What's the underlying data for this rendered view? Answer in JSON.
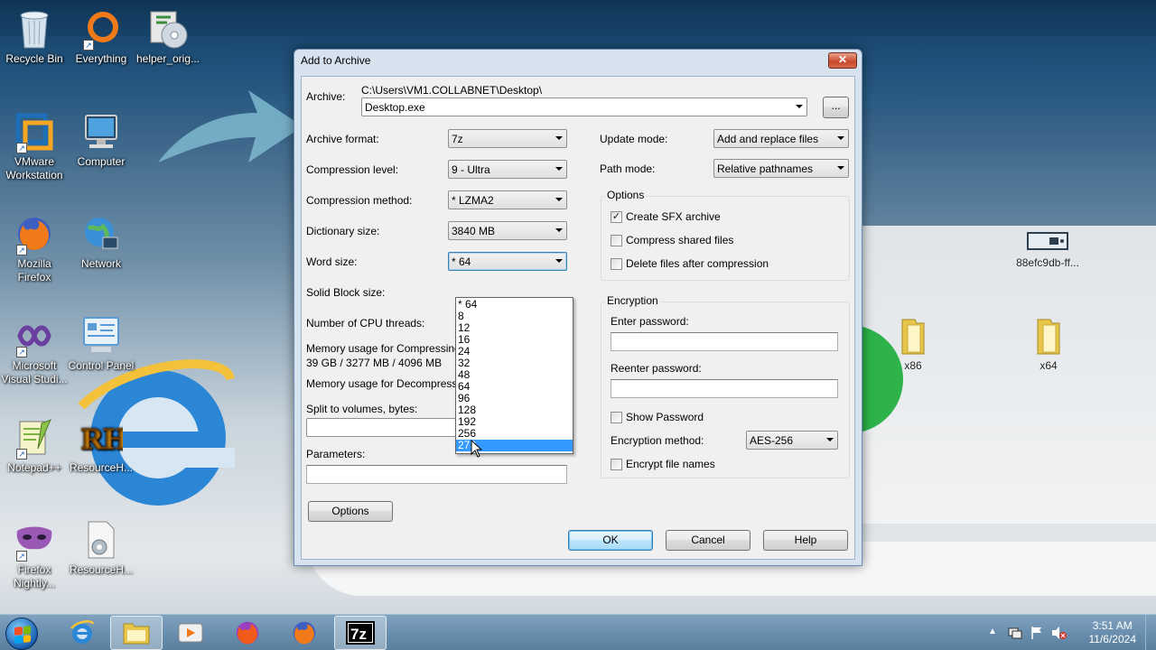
{
  "desktop": {
    "icons": [
      {
        "label": "Recycle Bin"
      },
      {
        "label": "Everything"
      },
      {
        "label": "helper_orig..."
      },
      {
        "label": "VMware Workstation"
      },
      {
        "label": "Computer"
      },
      {
        "label": "Mozilla Firefox"
      },
      {
        "label": "Network"
      },
      {
        "label": "Microsoft Visual Studi..."
      },
      {
        "label": "Control Panel"
      },
      {
        "label": "Notepad++"
      },
      {
        "label": "ResourceH..."
      },
      {
        "label": "Firefox Nightly..."
      },
      {
        "label": "ResourceH..."
      },
      {
        "label": "88efc9db-ff..."
      },
      {
        "label": "x86"
      },
      {
        "label": "x64"
      }
    ]
  },
  "dialog": {
    "title": "Add to Archive",
    "archive_label": "Archive:",
    "archive_path": "C:\\Users\\VM1.COLLABNET\\Desktop\\",
    "archive_name": "Desktop.exe",
    "browse_label": "...",
    "archive_format_label": "Archive format:",
    "archive_format": "7z",
    "compression_level_label": "Compression level:",
    "compression_level": "9 - Ultra",
    "compression_method_label": "Compression method:",
    "compression_method": "* LZMA2",
    "dictionary_size_label": "Dictionary size:",
    "dictionary_size": "3840 MB",
    "word_size_label": "Word size:",
    "word_size": "* 64",
    "solid_block_label": "Solid Block size:",
    "cpu_threads_label": "Number of CPU threads:",
    "mem_compress_label": "Memory usage for Compressing:",
    "mem_compress_value": "39 GB / 3277 MB / 4096 MB",
    "mem_decompress_label": "Memory usage for Decompressing:",
    "split_label": "Split to volumes, bytes:",
    "parameters_label": "Parameters:",
    "options_button": "Options",
    "update_mode_label": "Update mode:",
    "update_mode": "Add and replace files",
    "path_mode_label": "Path mode:",
    "path_mode": "Relative pathnames",
    "options_group": {
      "title": "Options",
      "create_sfx": {
        "label": "Create SFX archive",
        "checked": true
      },
      "compress_shared": {
        "label": "Compress shared files",
        "checked": false
      },
      "delete_after": {
        "label": "Delete files after compression",
        "checked": false
      }
    },
    "encryption_group": {
      "title": "Encryption",
      "enter_password_label": "Enter password:",
      "reenter_password_label": "Reenter password:",
      "show_password": {
        "label": "Show Password",
        "checked": false
      },
      "method_label": "Encryption method:",
      "method": "AES-256",
      "encrypt_names": {
        "label": "Encrypt file names",
        "checked": false
      }
    },
    "ok_button": "OK",
    "cancel_button": "Cancel",
    "help_button": "Help",
    "word_size_options": [
      "* 64",
      "8",
      "12",
      "16",
      "24",
      "32",
      "48",
      "64",
      "96",
      "128",
      "192",
      "256",
      "273"
    ],
    "word_size_highlighted": "273"
  },
  "taskbar": {
    "time": "3:51 AM",
    "date": "11/6/2024"
  }
}
